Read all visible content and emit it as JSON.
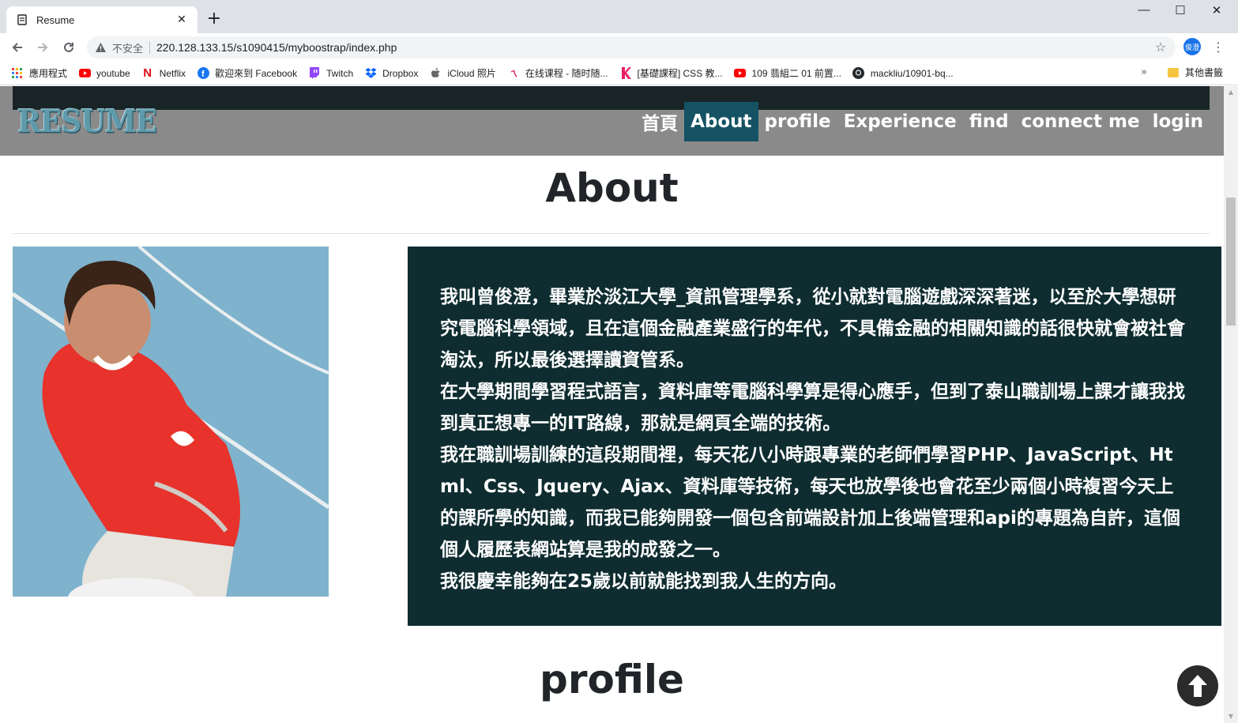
{
  "browser": {
    "tab_title": "Resume",
    "tab_close": "✕",
    "new_tab": "+",
    "win_min": "—",
    "win_max": "☐",
    "win_close": "✕",
    "insecure_label": "不安全",
    "url": "220.128.133.15/s1090415/myboostrap/index.php",
    "profile_initials": "俊澄",
    "menu": "⋮",
    "bookmarks": [
      {
        "label": "應用程式",
        "icon": "apps-grid-icon",
        "color": "#e8453c"
      },
      {
        "label": "youtube",
        "icon": "youtube-icon",
        "color": "#ff0000"
      },
      {
        "label": "Netflix",
        "icon": "netflix-icon",
        "color": "#e50914"
      },
      {
        "label": "歡迎來到 Facebook",
        "icon": "facebook-icon",
        "color": "#1877f2"
      },
      {
        "label": "Twitch",
        "icon": "twitch-icon",
        "color": "#9146ff"
      },
      {
        "label": "Dropbox",
        "icon": "dropbox-icon",
        "color": "#0061ff"
      },
      {
        "label": "iCloud 照片",
        "icon": "apple-icon",
        "color": "#555555"
      },
      {
        "label": "在线课程 - 随时随...",
        "icon": "course-icon",
        "color": "#e0245e"
      },
      {
        "label": "[基礎課程] CSS 教...",
        "icon": "k-icon",
        "color": "#e91e63"
      },
      {
        "label": "109 翡組二 01 前置...",
        "icon": "youtube-icon",
        "color": "#ff0000"
      },
      {
        "label": "mackliu/10901-bq...",
        "icon": "github-icon",
        "color": "#24292e"
      }
    ],
    "bookmarks_more": "»",
    "other_bookmarks": "其他書籤"
  },
  "site": {
    "logo": "RESUME",
    "nav": [
      {
        "label": "首頁",
        "active": false
      },
      {
        "label": "About",
        "active": true
      },
      {
        "label": "profile",
        "active": false
      },
      {
        "label": "Experience",
        "active": false
      },
      {
        "label": "find",
        "active": false
      },
      {
        "label": "connect me",
        "active": false
      },
      {
        "label": "login",
        "active": false
      }
    ],
    "about_title": "About",
    "about_paragraphs": [
      "我叫曾俊澄，畢業於淡江大學_資訊管理學系，從小就對電腦遊戲深深著迷，以至於大學想研究電腦科學領域，且在這個金融產業盛行的年代，不具備金融的相關知識的話很快就會被社會淘汰，所以最後選擇讀資管系。",
      "在大學期間學習程式語言，資料庫等電腦科學算是得心應手，但到了泰山職訓場上課才讓我找到真正想專一的IT路線，那就是網頁全端的技術。",
      "我在職訓場訓練的這段期間裡，每天花八小時跟專業的老師們學習PHP、JavaScript、Html、Css、Jquery、Ajax、資料庫等技術，每天也放學後也會花至少兩個小時複習今天上的課所學的知識，而我已能夠開發一個包含前端設計加上後端管理和api的專題為自許，這個個人履歷表網站算是我的成發之一。",
      "我很慶幸能夠在25歲以前就能找到我人生的方向。"
    ],
    "profile_title": "profile"
  },
  "colors": {
    "navbar_bg": "#8a8a8a",
    "navbar_top": "#182426",
    "nav_active": "#155264",
    "about_box": "#0f2d30"
  }
}
